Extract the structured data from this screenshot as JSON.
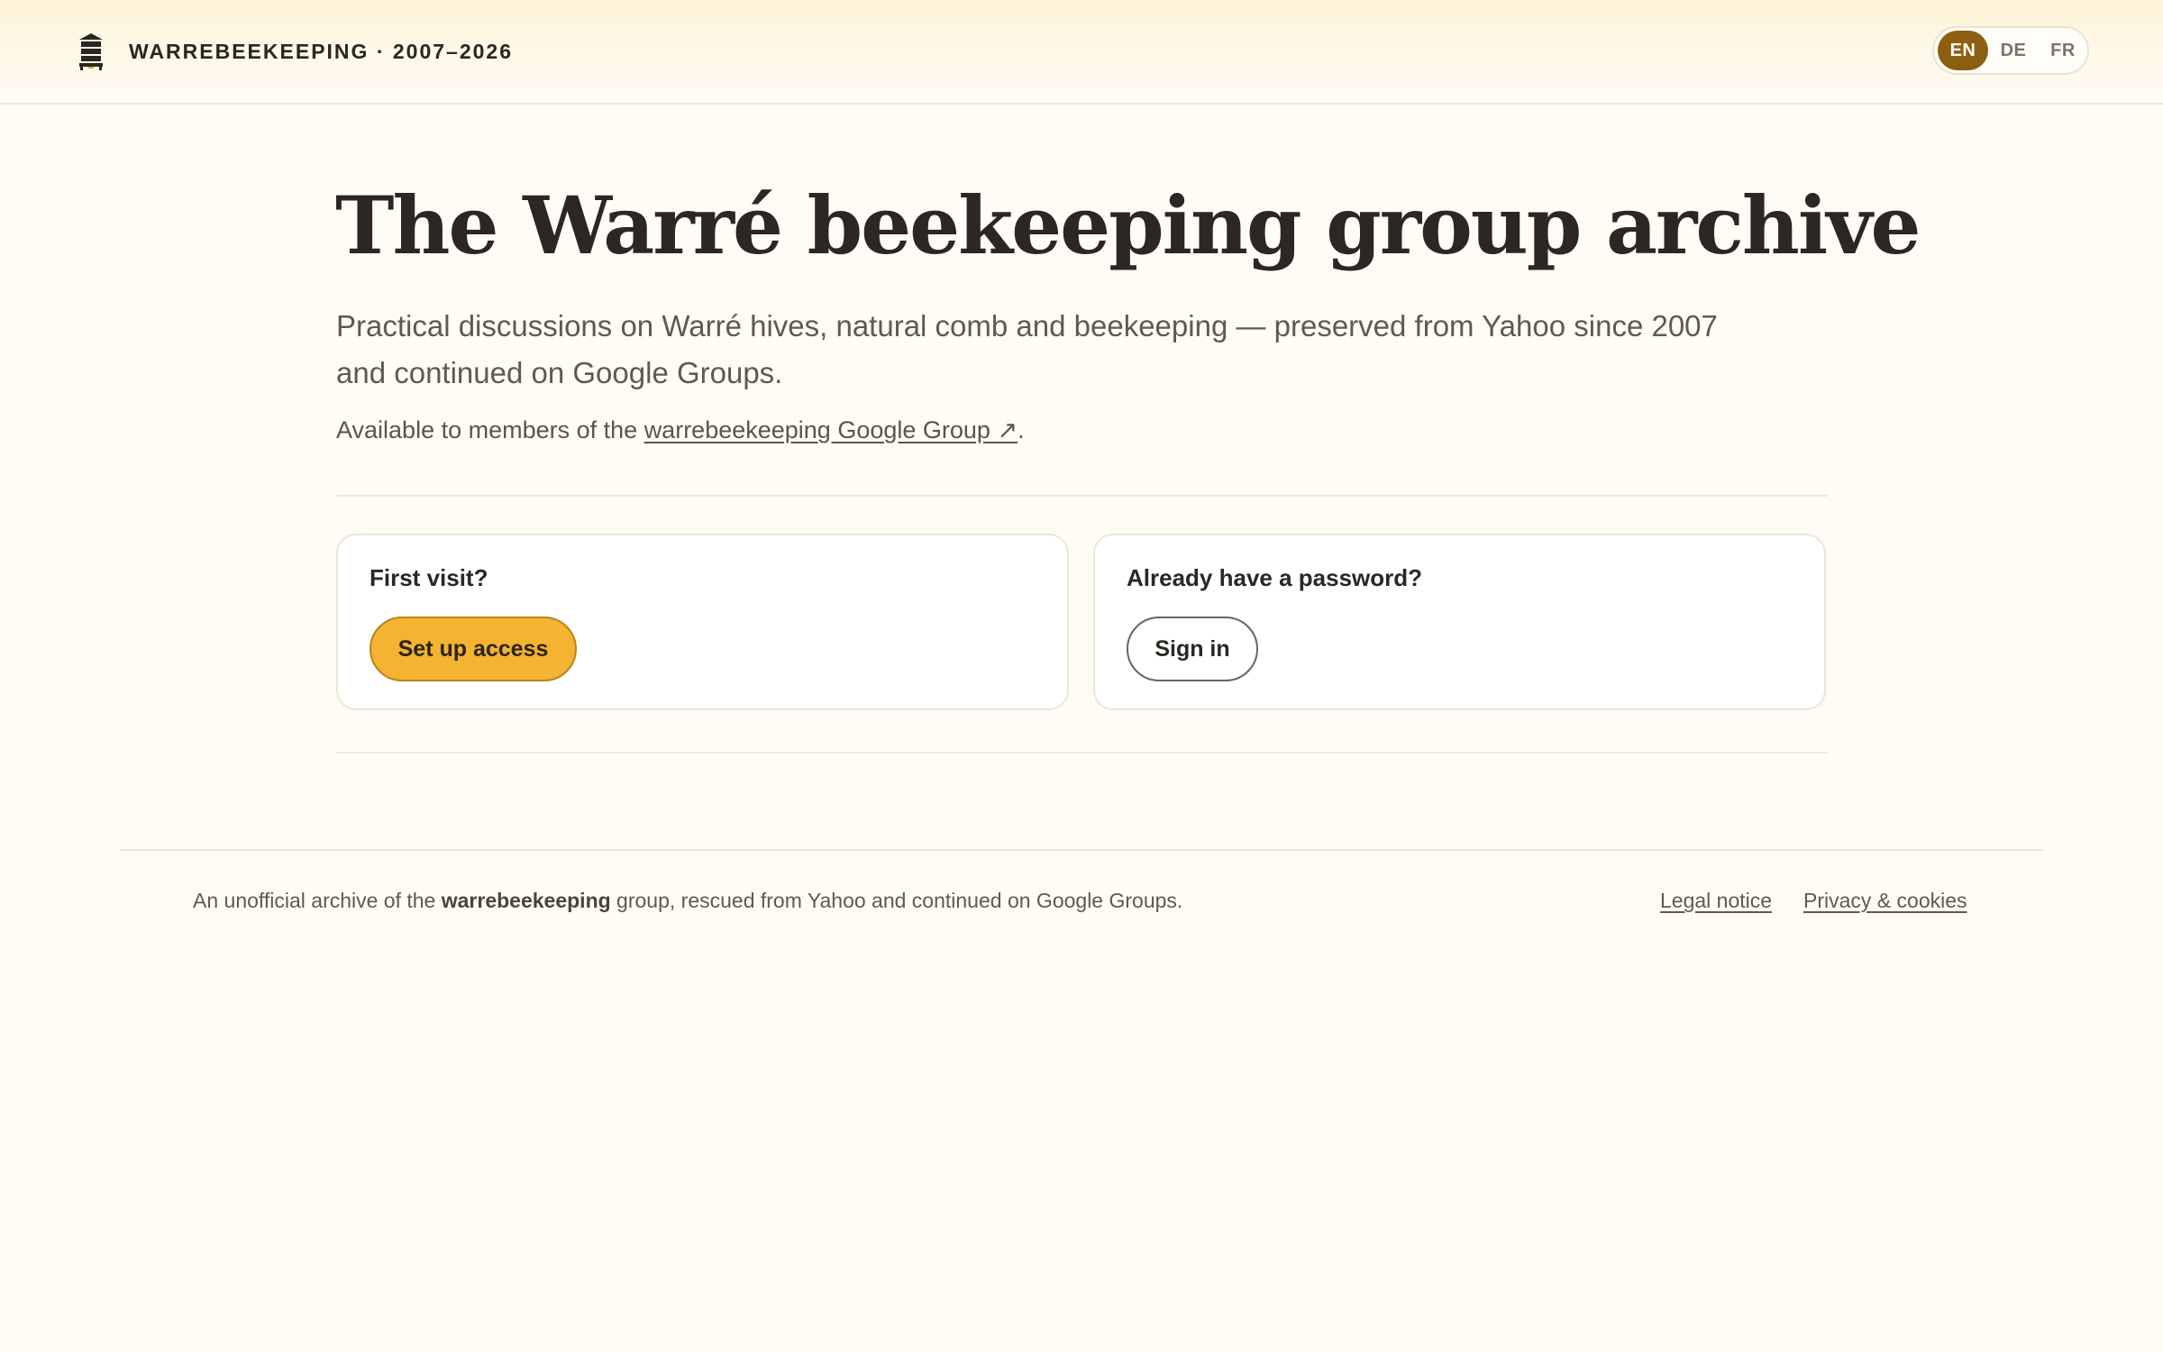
{
  "header": {
    "brand": "WARREBEEKEEPING · 2007–2026",
    "icon": "hive-icon",
    "languages": [
      {
        "code": "EN",
        "active": true
      },
      {
        "code": "DE",
        "active": false
      },
      {
        "code": "FR",
        "active": false
      }
    ],
    "accent_color": "#8e5e10"
  },
  "hero": {
    "title": "The Warré beekeeping group archive",
    "subtitle": "Practical discussions on Warré hives, natural comb and beekeeping — preserved from Yahoo since 2007 and continued on Google Groups.",
    "members_prefix": "Available to members of the ",
    "members_link": "warrebeekeeping Google Group ↗",
    "members_suffix": "."
  },
  "cards": {
    "first_visit": {
      "label": "First visit?",
      "button": "Set up access",
      "button_color": "#f2b431"
    },
    "returning": {
      "label": "Already have a password?",
      "button": "Sign in"
    }
  },
  "footer": {
    "text_prefix": "An unofficial archive of the ",
    "text_bold": "warrebeekeeping",
    "text_suffix": " group, rescued from Yahoo and continued on Google Groups.",
    "legal": "Legal notice",
    "privacy": "Privacy & cookies"
  }
}
